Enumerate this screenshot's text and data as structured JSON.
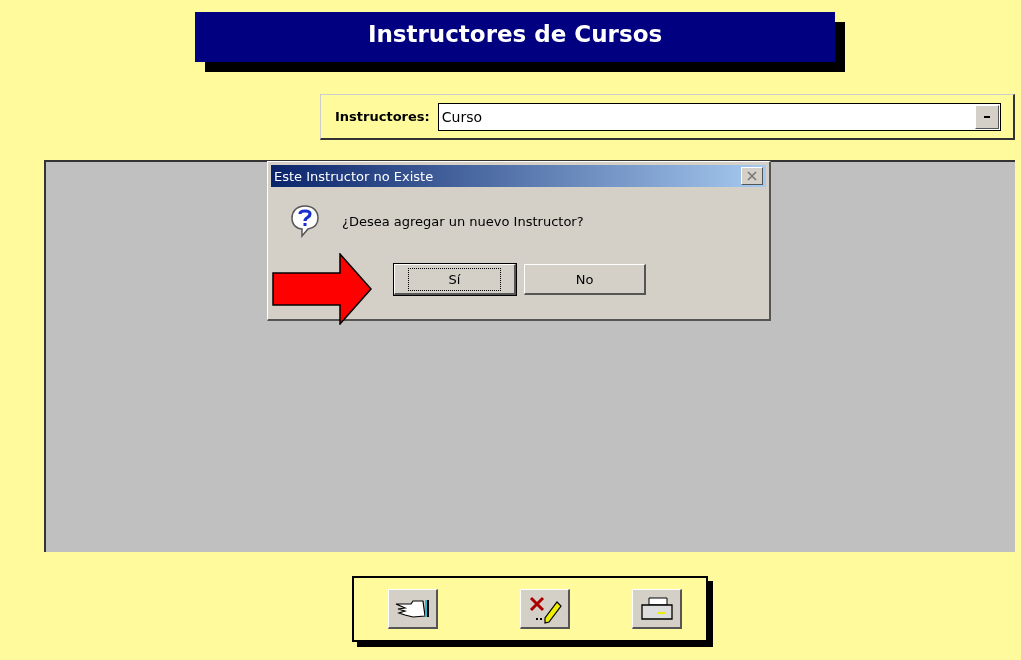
{
  "title": "Instructores de Cursos",
  "filter": {
    "label": "Instructores:",
    "value": "Curso"
  },
  "dialog": {
    "title": "Este Instructor no Existe",
    "message": "¿Desea agregar un nuevo Instructor?",
    "buttons": [
      {
        "label": "Sí",
        "focused": true
      },
      {
        "label": "No",
        "focused": false
      }
    ]
  }
}
